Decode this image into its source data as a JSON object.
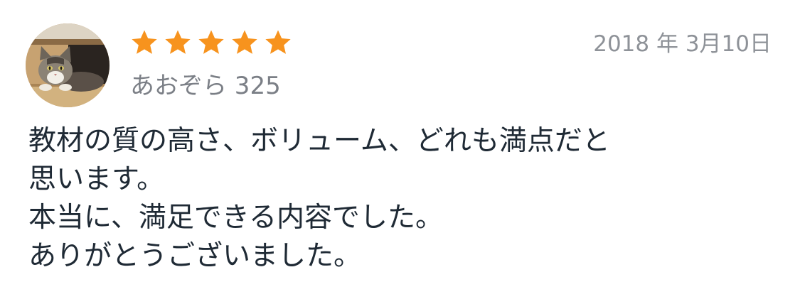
{
  "review": {
    "author": "あおぞら 325",
    "date": "2018 年 3月10日",
    "rating": 5,
    "rating_max": 5,
    "star_color": "#f7931e",
    "avatar_icon": "cat-photo-icon",
    "star_icon": "star-icon",
    "body_lines": [
      "教材の質の高さ、ボリューム、どれも満点だと",
      "思います。",
      "本当に、満足できる内容でした。",
      "ありがとうございました。"
    ]
  }
}
